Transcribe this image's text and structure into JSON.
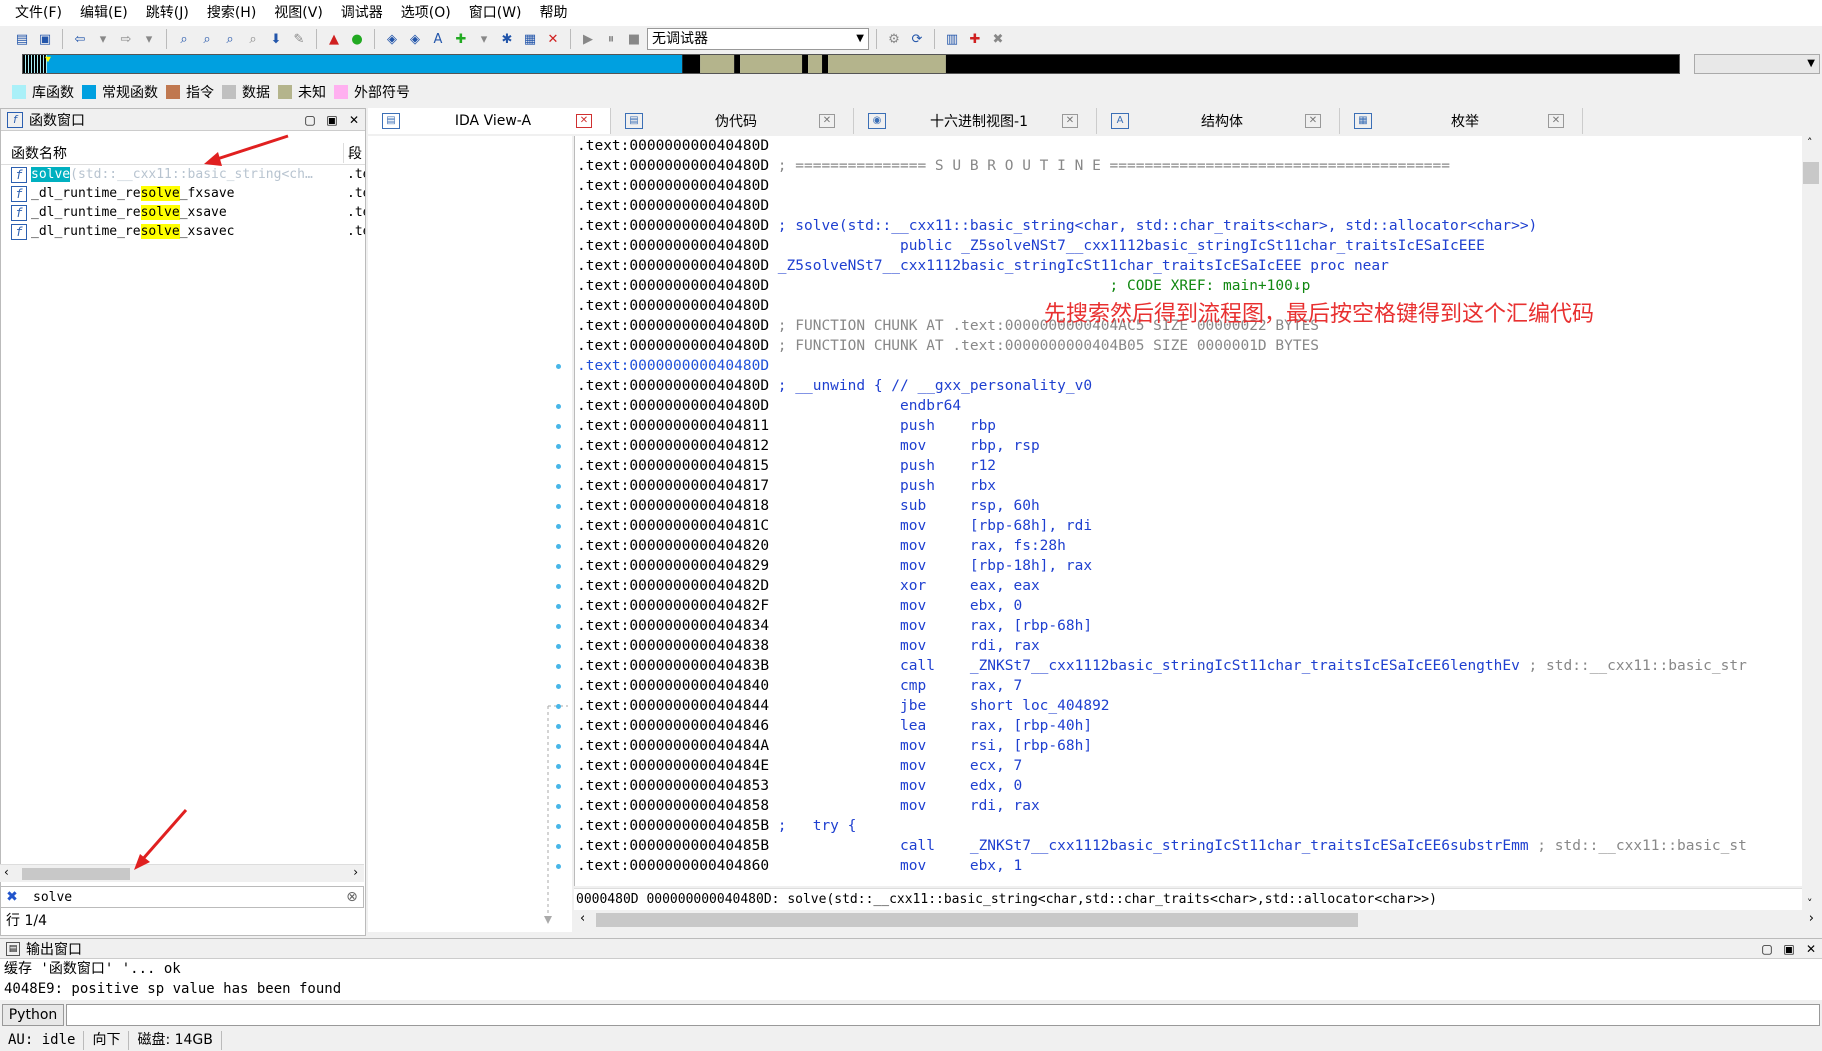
{
  "menubar": [
    "文件(F)",
    "编辑(E)",
    "跳转(J)",
    "搜索(H)",
    "视图(V)",
    "调试器",
    "选项(O)",
    "窗口(W)",
    "帮助"
  ],
  "toolbar": {
    "debugger_select": "无调试器"
  },
  "legend": [
    {
      "label": "库函数",
      "color": "#aaf0f8"
    },
    {
      "label": "常规函数",
      "color": "#00a0e0"
    },
    {
      "label": "指令",
      "color": "#c07850"
    },
    {
      "label": "数据",
      "color": "#c0c0c0"
    },
    {
      "label": "未知",
      "color": "#b4b48c"
    },
    {
      "label": "外部符号",
      "color": "#ffb0f0"
    }
  ],
  "func_window": {
    "title": "函数窗口",
    "col_name": "函数名称",
    "col_seg": "段",
    "rows": [
      {
        "pre": "",
        "hl": "solve",
        "post": "(std::__cxx11::basic_string<ch…",
        "seg": ".te",
        "selected": true
      },
      {
        "pre": "_dl_runtime_re",
        "hl": "solve",
        "post": "_fxsave",
        "seg": ".te",
        "selected": false
      },
      {
        "pre": "_dl_runtime_re",
        "hl": "solve",
        "post": "_xsave",
        "seg": ".te",
        "selected": false
      },
      {
        "pre": "_dl_runtime_re",
        "hl": "solve",
        "post": "_xsavec",
        "seg": ".te",
        "selected": false
      }
    ],
    "search_value": "solve",
    "status": "行 1/4"
  },
  "tabs": [
    {
      "label": "IDA View-A",
      "active": true
    },
    {
      "label": "伪代码",
      "active": false
    },
    {
      "label": "十六进制视图-1",
      "active": false
    },
    {
      "label": "结构体",
      "active": false
    },
    {
      "label": "枚举",
      "active": false
    }
  ],
  "ida_lines": [
    {
      "addr": ".text:000000000040480D",
      "parts": []
    },
    {
      "addr": ".text:000000000040480D",
      "parts": [
        {
          "t": " ; =============== S U B R O U T I N E =======================================",
          "c": "gray"
        }
      ]
    },
    {
      "addr": ".text:000000000040480D",
      "parts": []
    },
    {
      "addr": ".text:000000000040480D",
      "parts": []
    },
    {
      "addr": ".text:000000000040480D",
      "parts": [
        {
          "t": " ; solve(std::__cxx11::basic_string<char, std::char_traits<char>, std::allocator<char>>)",
          "c": "blue"
        }
      ]
    },
    {
      "addr": ".text:000000000040480D",
      "parts": [
        {
          "t": "               public _Z5solveNSt7__cxx1112basic_stringIcSt11char_traitsIcESaIcEEE",
          "c": "blue"
        }
      ]
    },
    {
      "addr": ".text:000000000040480D",
      "parts": [
        {
          "t": " _Z5solveNSt7__cxx1112basic_stringIcSt11char_traitsIcESaIcEEE proc near",
          "c": "blue"
        }
      ]
    },
    {
      "addr": ".text:000000000040480D",
      "parts": [
        {
          "t": "                                       ; CODE XREF: main+100↓p",
          "c": "green"
        }
      ]
    },
    {
      "addr": ".text:000000000040480D",
      "parts": []
    },
    {
      "addr": ".text:000000000040480D",
      "parts": [
        {
          "t": " ; FUNCTION CHUNK AT .text:0000000000404AC5 SIZE 00000022 BYTES",
          "c": "gray"
        }
      ]
    },
    {
      "addr": ".text:000000000040480D",
      "parts": [
        {
          "t": " ; FUNCTION CHUNK AT .text:0000000000404B05 SIZE 0000001D BYTES",
          "c": "gray"
        }
      ]
    },
    {
      "addr": ".text:000000000040480D",
      "sel": true,
      "parts": []
    },
    {
      "addr": ".text:000000000040480D",
      "parts": [
        {
          "t": " ; __unwind { // __gxx_personality_v0",
          "c": "blue"
        }
      ]
    },
    {
      "addr": ".text:000000000040480D",
      "parts": [
        {
          "t": "               endbr64",
          "c": "blue"
        }
      ]
    },
    {
      "addr": ".text:0000000000404811",
      "parts": [
        {
          "t": "               push    rbp",
          "c": "blue"
        }
      ]
    },
    {
      "addr": ".text:0000000000404812",
      "parts": [
        {
          "t": "               mov     rbp, rsp",
          "c": "blue"
        }
      ]
    },
    {
      "addr": ".text:0000000000404815",
      "parts": [
        {
          "t": "               push    r12",
          "c": "blue"
        }
      ]
    },
    {
      "addr": ".text:0000000000404817",
      "parts": [
        {
          "t": "               push    rbx",
          "c": "blue"
        }
      ]
    },
    {
      "addr": ".text:0000000000404818",
      "parts": [
        {
          "t": "               sub     rsp, 60h",
          "c": "blue"
        }
      ]
    },
    {
      "addr": ".text:000000000040481C",
      "parts": [
        {
          "t": "               mov     [rbp-68h], rdi",
          "c": "blue"
        }
      ]
    },
    {
      "addr": ".text:0000000000404820",
      "parts": [
        {
          "t": "               mov     rax, fs:28h",
          "c": "blue"
        }
      ]
    },
    {
      "addr": ".text:0000000000404829",
      "parts": [
        {
          "t": "               mov     [rbp-18h], rax",
          "c": "blue"
        }
      ]
    },
    {
      "addr": ".text:000000000040482D",
      "parts": [
        {
          "t": "               xor     eax, eax",
          "c": "blue"
        }
      ]
    },
    {
      "addr": ".text:000000000040482F",
      "parts": [
        {
          "t": "               mov     ebx, 0",
          "c": "blue"
        }
      ]
    },
    {
      "addr": ".text:0000000000404834",
      "parts": [
        {
          "t": "               mov     rax, [rbp-68h]",
          "c": "blue"
        }
      ]
    },
    {
      "addr": ".text:0000000000404838",
      "parts": [
        {
          "t": "               mov     rdi, rax",
          "c": "blue"
        }
      ]
    },
    {
      "addr": ".text:000000000040483B",
      "parts": [
        {
          "t": "               call    _ZNKSt7__cxx1112basic_stringIcSt11char_traitsIcESaIcEE6lengthEv",
          "c": "blue"
        },
        {
          "t": " ; std::__cxx11::basic_str",
          "c": "gray"
        }
      ]
    },
    {
      "addr": ".text:0000000000404840",
      "parts": [
        {
          "t": "               cmp     rax, 7",
          "c": "blue"
        }
      ]
    },
    {
      "addr": ".text:0000000000404844",
      "parts": [
        {
          "t": "               jbe     short loc_404892",
          "c": "blue"
        }
      ]
    },
    {
      "addr": ".text:0000000000404846",
      "parts": [
        {
          "t": "               lea     rax, [rbp-40h]",
          "c": "blue"
        }
      ]
    },
    {
      "addr": ".text:000000000040484A",
      "parts": [
        {
          "t": "               mov     rsi, [rbp-68h]",
          "c": "blue"
        }
      ]
    },
    {
      "addr": ".text:000000000040484E",
      "parts": [
        {
          "t": "               mov     ecx, 7",
          "c": "blue"
        }
      ]
    },
    {
      "addr": ".text:0000000000404853",
      "parts": [
        {
          "t": "               mov     edx, 0",
          "c": "blue"
        }
      ]
    },
    {
      "addr": ".text:0000000000404858",
      "parts": [
        {
          "t": "               mov     rdi, rax",
          "c": "blue"
        }
      ]
    },
    {
      "addr": ".text:000000000040485B",
      "parts": [
        {
          "t": " ;   try {",
          "c": "blue"
        }
      ]
    },
    {
      "addr": ".text:000000000040485B",
      "parts": [
        {
          "t": "               call    _ZNKSt7__cxx1112basic_stringIcSt11char_traitsIcESaIcEE6substrEmm",
          "c": "blue"
        },
        {
          "t": " ; std::__cxx11::basic_st",
          "c": "gray"
        }
      ]
    },
    {
      "addr": ".text:0000000000404860",
      "parts": [
        {
          "t": "               mov     ebx, 1",
          "c": "blue"
        }
      ]
    }
  ],
  "ida_status": "0000480D 000000000040480D: solve(std::__cxx11::basic_string<char,std::char_traits<char>,std::allocator<char>>)",
  "annotation": "先搜索然后得到流程图，最后按空格键得到这个汇编代码",
  "output_window": {
    "title": "输出窗口",
    "lines": [
      "缓存 '函数窗口' '... ok",
      "4048E9: positive sp value has been found"
    ]
  },
  "python_label": "Python",
  "statusbar": {
    "au": "AU:",
    "state": "idle",
    "dir": "向下",
    "disk": "磁盘: 14GB"
  }
}
